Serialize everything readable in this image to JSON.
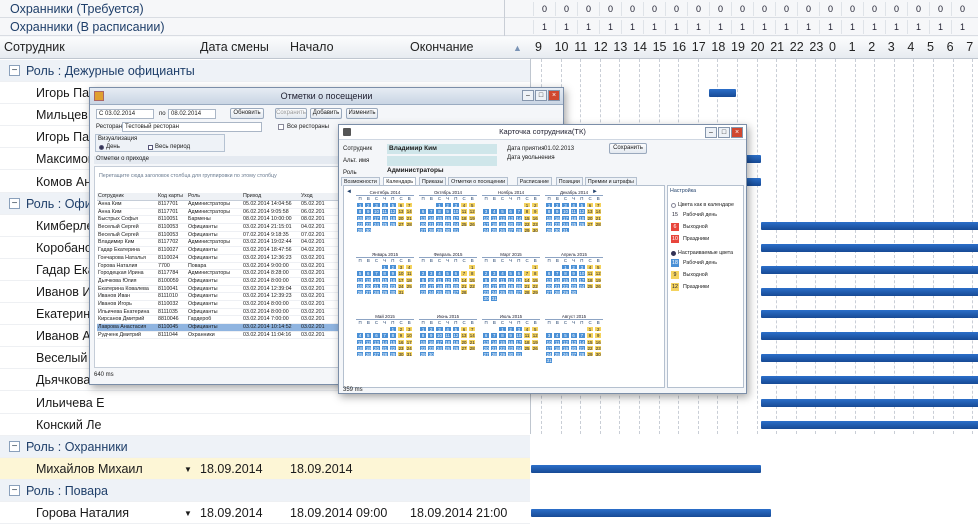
{
  "top_rows": [
    {
      "label": "Охранники (Требуется)",
      "cells": [
        "0",
        "0",
        "0",
        "0",
        "0",
        "0",
        "0",
        "0",
        "0",
        "0",
        "0",
        "0",
        "0",
        "0",
        "0",
        "0",
        "0",
        "0",
        "0",
        "0"
      ]
    },
    {
      "label": "Охранники (В расписании)",
      "cells": [
        "1",
        "1",
        "1",
        "1",
        "1",
        "1",
        "1",
        "1",
        "1",
        "1",
        "1",
        "1",
        "1",
        "1",
        "1",
        "1",
        "1",
        "1",
        "1",
        "1"
      ]
    }
  ],
  "header": {
    "col_employee": "Сотрудник",
    "col_shift_date": "Дата смены",
    "col_start": "Начало",
    "col_end": "Окончание",
    "sort_glyph": "▲",
    "hours": [
      "9",
      "10",
      "11",
      "12",
      "13",
      "14",
      "15",
      "16",
      "17",
      "18",
      "19",
      "20",
      "21",
      "22",
      "23",
      "0",
      "1",
      "2",
      "3",
      "4",
      "5",
      "6",
      "7"
    ]
  },
  "rows": [
    {
      "kind": "role",
      "text": "Роль : Дежурные официанты"
    },
    {
      "kind": "emp",
      "text": "Игорь Паны"
    },
    {
      "kind": "emp",
      "text": "Мильцев Ал"
    },
    {
      "kind": "emp",
      "text": "Игорь Паны"
    },
    {
      "kind": "emp",
      "text": "Максимова"
    },
    {
      "kind": "emp",
      "text": "Комов Андр"
    },
    {
      "kind": "role",
      "text": "Роль : Офи"
    },
    {
      "kind": "emp",
      "text": "Кимберле О"
    },
    {
      "kind": "emp",
      "text": "Коробанов"
    },
    {
      "kind": "emp",
      "text": "Гадар Екат"
    },
    {
      "kind": "emp",
      "text": "Иванов Иго"
    },
    {
      "kind": "emp",
      "text": "Екатерина"
    },
    {
      "kind": "emp",
      "text": "Иванов Але"
    },
    {
      "kind": "emp",
      "text": "Веселый Се"
    },
    {
      "kind": "emp",
      "text": "Дьячкова К"
    },
    {
      "kind": "emp",
      "text": "Ильичева Е"
    },
    {
      "kind": "emp",
      "text": "Конский Ле"
    },
    {
      "kind": "role",
      "text": "Роль : Охранники"
    },
    {
      "kind": "emp",
      "text": "Михайлов Михаил",
      "date": "18.09.2014",
      "start": "18.09.2014",
      "end": ""
    },
    {
      "kind": "role",
      "text": "Роль : Повара"
    },
    {
      "kind": "emp",
      "text": "Горова Наталия",
      "date": "18.09.2014",
      "start": "18.09.2014 09:00",
      "end": "18.09.2014 21:00"
    }
  ],
  "win1": {
    "title": "Отметки о посещении",
    "date_from": "С  03.02.2014",
    "to_label": "по",
    "date_to": "08.02.2014",
    "refresh": "Обновить",
    "save": "Сохранить",
    "add": "Добавить",
    "edit": "Изменить",
    "restaurant_label": "Ресторан",
    "restaurant_value": "Тестовый ресторан",
    "all_restaurants": "Все рестораны",
    "viz_label": "Визуализация",
    "day_label": "День",
    "period_label": "Весь период",
    "section": "Отметки о приходе",
    "group_hint": "Перетащите сюда заголовок столбца для группировки по этому столбцу",
    "columns": [
      "Сотрудник",
      "Код карты",
      "Роль",
      "Приход",
      "Уход"
    ],
    "rows": [
      [
        "Анна Ким",
        "8117701",
        "Администраторы",
        "05.02.2014 14:04:56",
        "05.02.201"
      ],
      [
        "Анна Ким",
        "8117701",
        "Администраторы",
        "06.02.2014 9:05:58",
        "06.02.201"
      ],
      [
        "Быстрых Софья",
        "8110051",
        "Бармены",
        "08.02.2014 10:00:00",
        "08.02.201"
      ],
      [
        "Веселый Сергей",
        "8110053",
        "Официанты",
        "03.02.2014 21:15:01",
        "04.02.201"
      ],
      [
        "Веселый Сергей",
        "8110053",
        "Официанты",
        "07.02.2014 9:18:35",
        "07.02.201"
      ],
      [
        "Владимир Ким",
        "8117702",
        "Администраторы",
        "03.02.2014 19:02:44",
        "04.02.201"
      ],
      [
        "Гадар Екатерина",
        "8110027",
        "Официанты",
        "03.02.2014 18:47:56",
        "04.02.201"
      ],
      [
        "Гончарова Наталья",
        "8110024",
        "Официанты",
        "03.02.2014 12:36:23",
        "03.02.201"
      ],
      [
        "Горова Наталия",
        "7700",
        "Повара",
        "03.02.2014 9:00:00",
        "03.02.201"
      ],
      [
        "Городецкая Ирина",
        "8117784",
        "Администраторы",
        "03.02.2014 8:28:00",
        "03.02.201"
      ],
      [
        "Дьячкова Юлия",
        "8100059",
        "Официанты",
        "03.02.2014 8:00:00",
        "03.02.201"
      ],
      [
        "Екатерина Ковалева",
        "8110041",
        "Официанты",
        "03.02.2014 12:39:04",
        "03.02.201"
      ],
      [
        "Иванов Иван",
        "8111010",
        "Официанты",
        "03.02.2014 12:39:23",
        "03.02.201"
      ],
      [
        "Иванов Игорь",
        "8110032",
        "Официанты",
        "03.02.2014 8:00:00",
        "03.02.201"
      ],
      [
        "Ильичева Екатерина",
        "8111035",
        "Официанты",
        "03.02.2014 8:00:00",
        "03.02.201"
      ],
      [
        "Кирсанов Дмитрий",
        "8810046",
        "Гардероб",
        "03.02.2014 7:00:00",
        "03.02.201"
      ],
      [
        "Лаврова Анастасия",
        "8110045",
        "Официанты",
        "03.02.2014 10:14:52",
        "03.02.201"
      ],
      [
        "Рудченк Дмитрий",
        "8111044",
        "Охранники",
        "03.02.2014 11:04:16",
        "03.02.201"
      ]
    ],
    "status": "640 ms"
  },
  "win2": {
    "title": "Карточка сотрудника(ТК)",
    "employee_label": "Сотрудник",
    "employee_value": "Владимир Ким",
    "alt_label": "Альт. имя",
    "role_label": "Роль",
    "role_value": "Администраторы",
    "hire_label": "Дата приятия",
    "hire_value": "01.02.2013",
    "fire_label": "Дата увольнения",
    "fire_value": "-",
    "save": "Сохранить",
    "tabs": [
      "Возможности",
      "Календарь",
      "Приказы",
      "Отметки о посещении",
      "Расписание",
      "Позиции",
      "Премии и штрафы"
    ],
    "active_tab": "Календарь",
    "weekdays": [
      "П",
      "В",
      "С",
      "Ч",
      "П",
      "С",
      "В"
    ],
    "months": [
      "Сентябрь 2014",
      "Октябрь 2014",
      "Ноябрь 2014",
      "Декабрь 2014",
      "Январь 2015",
      "Февраль 2015",
      "Март 2015",
      "Апрель 2015",
      "Май 2015",
      "Июнь 2015",
      "Июль 2015",
      "Август 2015"
    ],
    "settings_title": "Настройка",
    "opt_calendar_colors": "Цвета как в календаре",
    "opt_custom_colors": "Настраиваемые цвета",
    "legend": [
      {
        "num": "15",
        "label": "Рабочий день"
      },
      {
        "num": "6",
        "label": "Выходной"
      },
      {
        "num": "10",
        "label": "Праздники"
      }
    ],
    "legend2": [
      {
        "num": "18",
        "label": "Рабочий день"
      },
      {
        "num": "9",
        "label": "Выходной"
      },
      {
        "num": "12",
        "label": "Праздники"
      }
    ],
    "status": "359 ms"
  },
  "colors": {
    "accent": "#1f5fbf",
    "selection": "#8fb4e0",
    "holiday": "#e8453c",
    "weekend": "#f4d35e",
    "workday": "#4a90d6"
  }
}
